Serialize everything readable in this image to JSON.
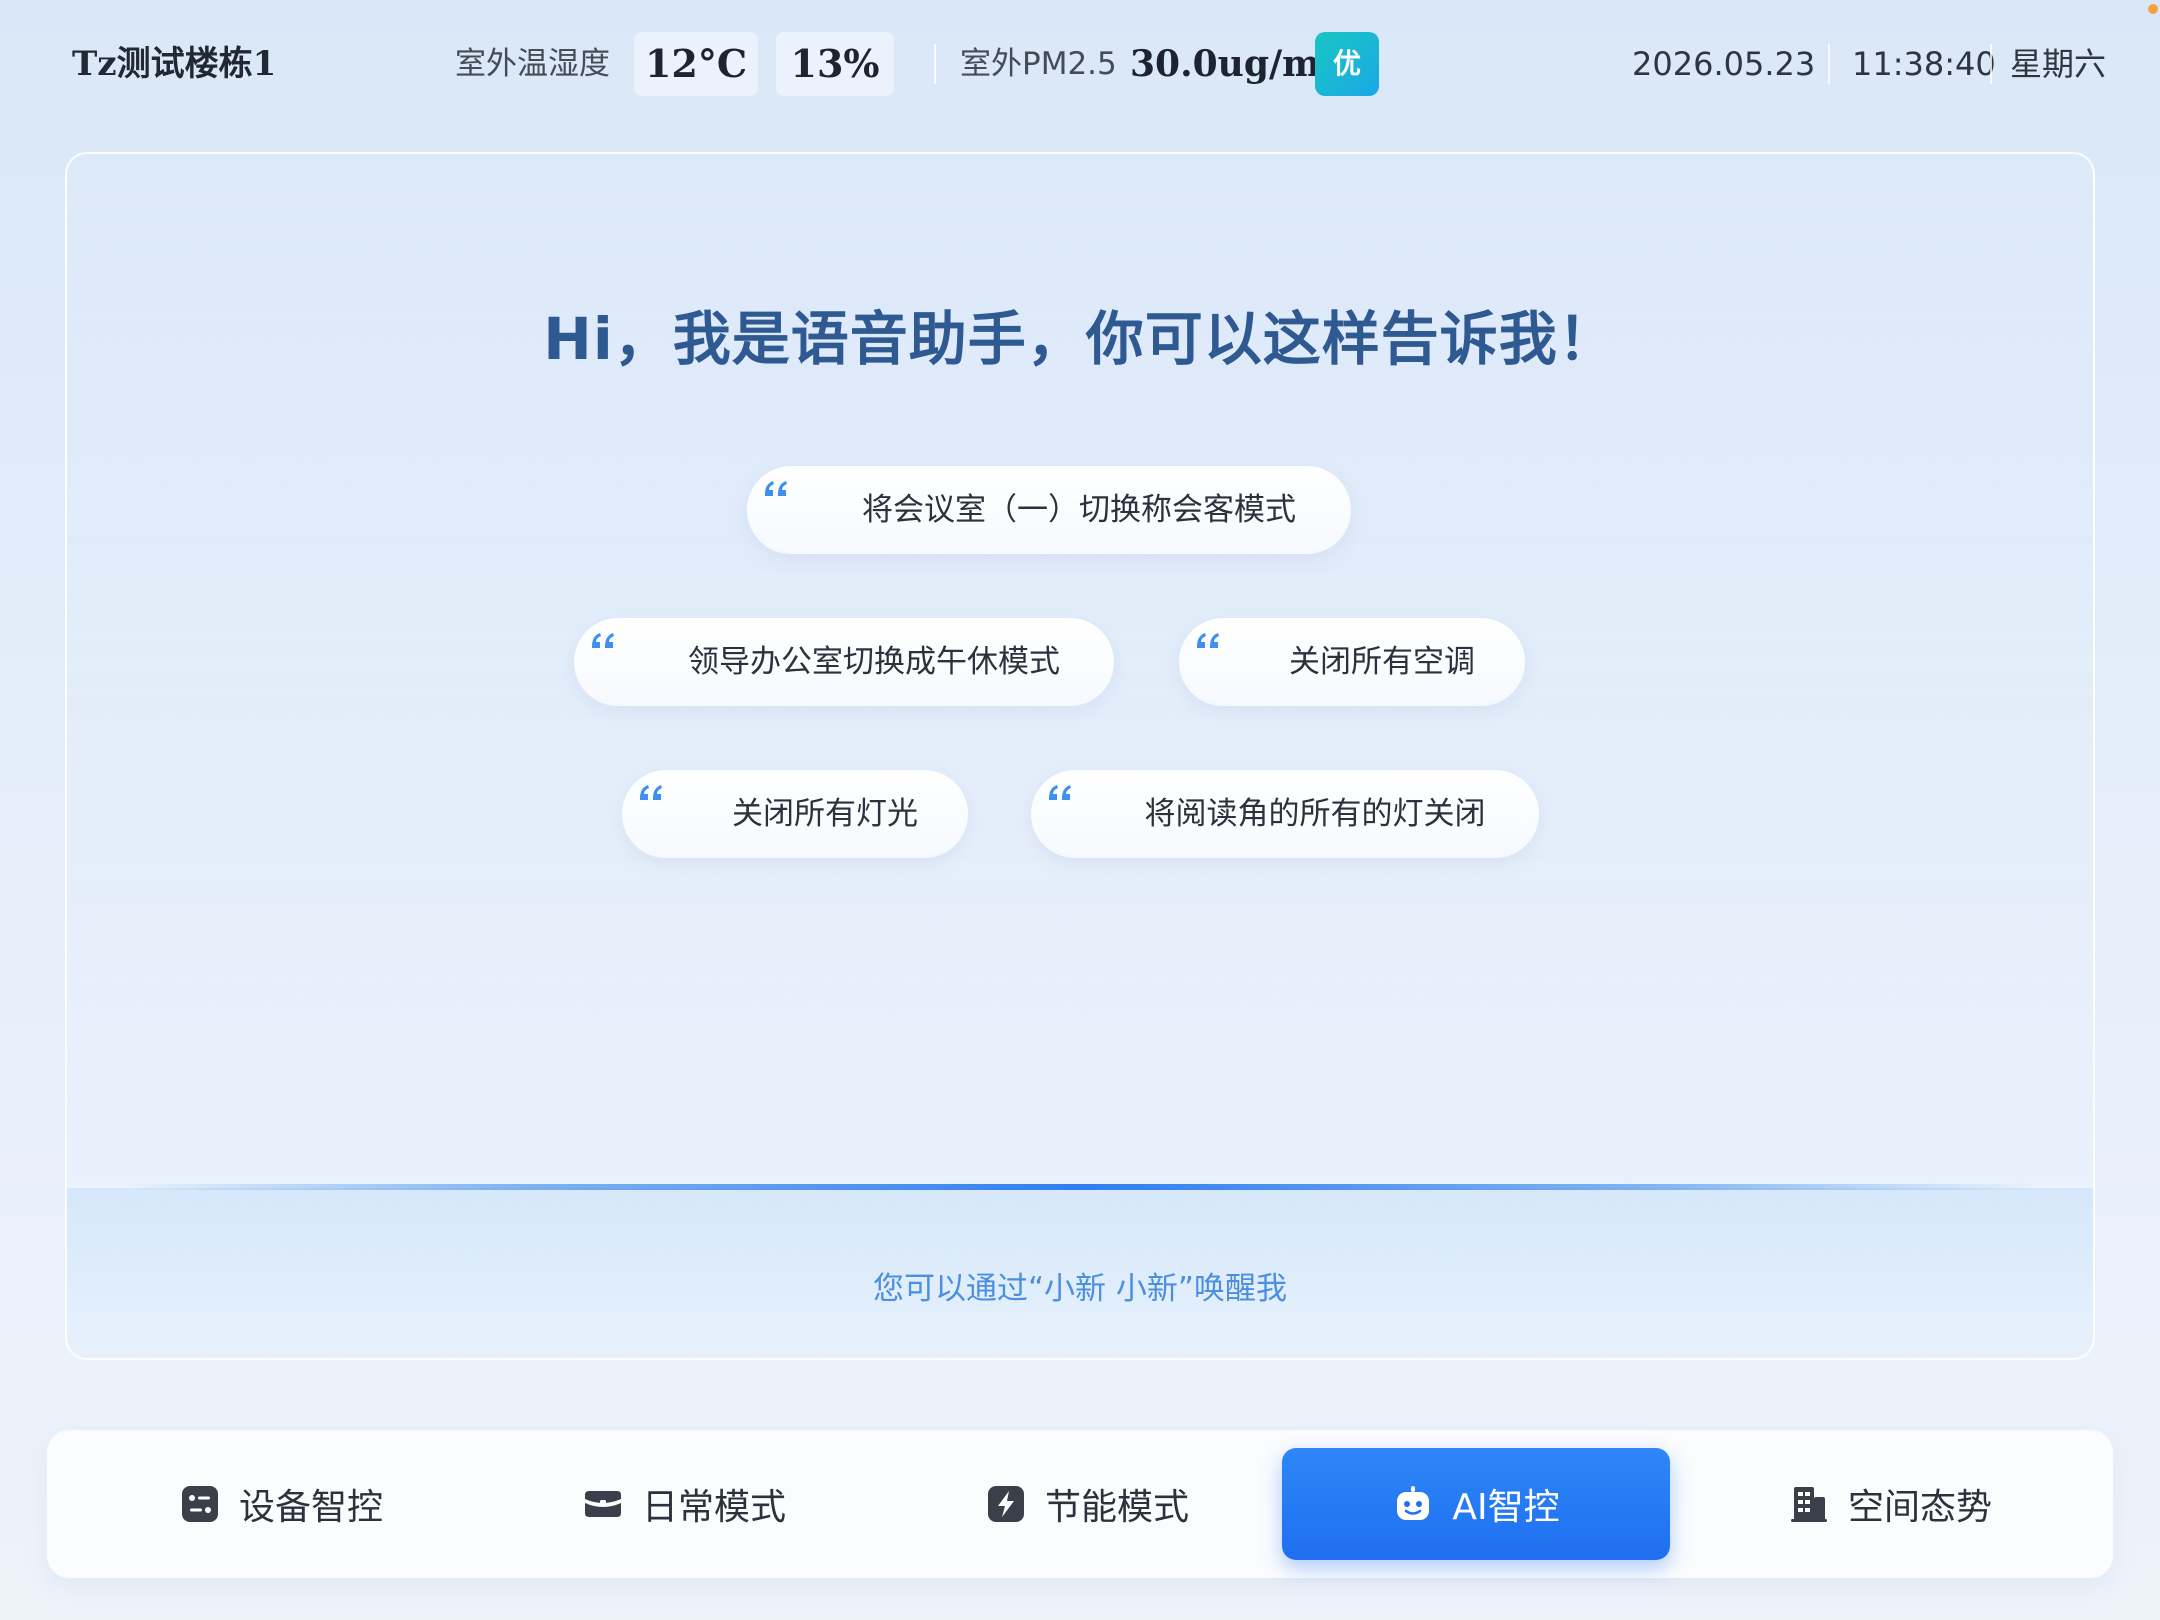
{
  "header": {
    "building_name": "Tz测试楼栋1",
    "outdoor_temp_humidity_label": "室外温湿度",
    "temperature": "12°C",
    "humidity": "13%",
    "outdoor_pm_label": "室外PM2.5",
    "pm_value": "30.0ug/m³",
    "air_quality_badge": "优",
    "date": "2026.05.23",
    "time": "11:38:40",
    "weekday": "星期六",
    "badge_color": "#1bb8d8"
  },
  "assistant": {
    "greeting": "Hi，我是语音助手，你可以这样告诉我！",
    "suggestions": [
      "将会议室（一）切换称会客模式",
      "领导办公室切换成午休模式",
      "关闭所有空调",
      "关闭所有灯光",
      "将阅读角的所有的灯关闭"
    ],
    "wake_hint": "您可以通过“小新 小新”唤醒我",
    "quote_icon": "quote-icon",
    "accent_color": "#2f5a91"
  },
  "nav": {
    "items": [
      {
        "label": "设备智控",
        "icon": "device-control-icon",
        "active": false
      },
      {
        "label": "日常模式",
        "icon": "daily-mode-icon",
        "active": false
      },
      {
        "label": "节能模式",
        "icon": "energy-saving-icon",
        "active": false
      },
      {
        "label": "AI智控",
        "icon": "robot-icon",
        "active": true
      },
      {
        "label": "空间态势",
        "icon": "building-icon",
        "active": false
      }
    ],
    "active_color": "#1f6ff0"
  }
}
